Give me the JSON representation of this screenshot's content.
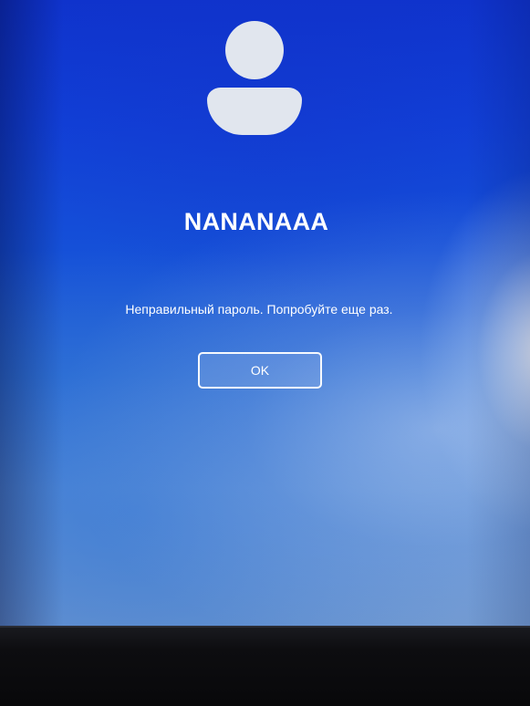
{
  "lock_screen": {
    "avatar_icon": "user-avatar-icon",
    "username": "NANANAAA",
    "error_message": "Неправильный пароль. Попробуйте еще раз.",
    "ok_label": "OK"
  },
  "colors": {
    "background_top": "#0f33cc",
    "background_bottom": "#6f98d0",
    "avatar_fill": "#e1e6ee",
    "text": "#ffffff",
    "bezel": "#0a0a0c"
  }
}
